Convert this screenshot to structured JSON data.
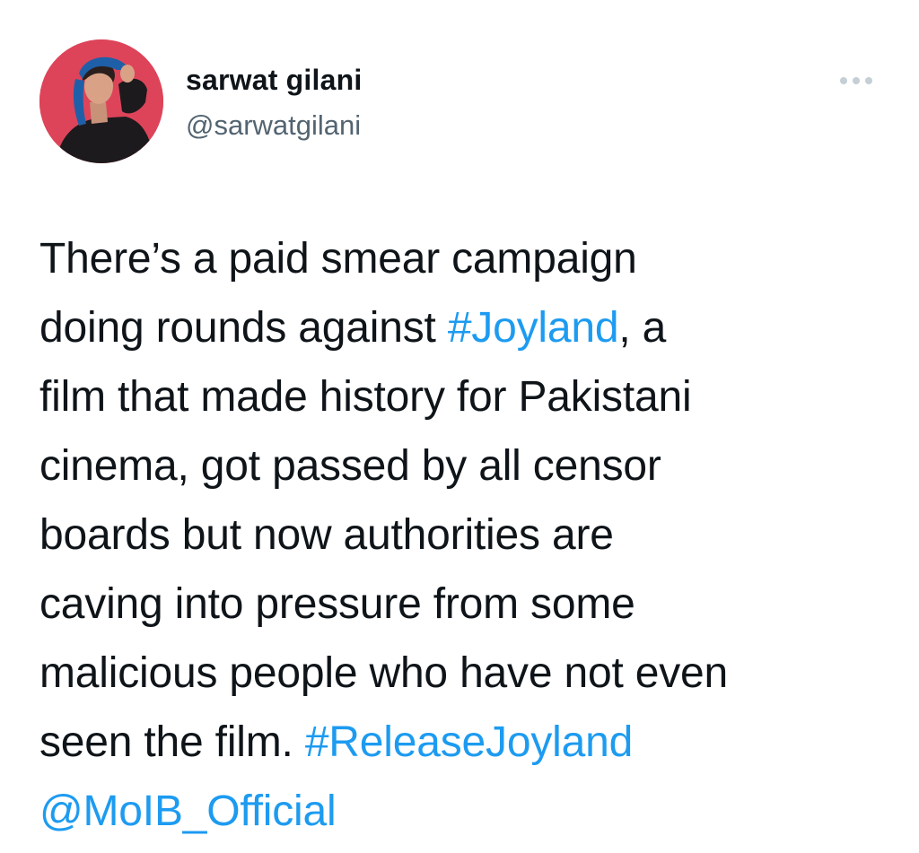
{
  "author": {
    "display_name": "sarwat gilani",
    "handle": "@sarwatgilani",
    "avatar_icon": "profile-photo"
  },
  "more_icon": "more-options-icon",
  "accent_color": "#1d9bf0",
  "tweet": {
    "lines": [
      [
        {
          "text": "There’s a paid smear campaign",
          "link": false
        }
      ],
      [
        {
          "text": "doing rounds against ",
          "link": false
        },
        {
          "text": "#Joyland",
          "link": true
        },
        {
          "text": ", a",
          "link": false
        }
      ],
      [
        {
          "text": "film that made history for Pakistani",
          "link": false
        }
      ],
      [
        {
          "text": "cinema, got passed by all censor",
          "link": false
        }
      ],
      [
        {
          "text": "boards but now authorities are",
          "link": false
        }
      ],
      [
        {
          "text": "caving into pressure from some",
          "link": false
        }
      ],
      [
        {
          "text": "malicious people who have not even",
          "link": false
        }
      ],
      [
        {
          "text": "seen the film. ",
          "link": false
        },
        {
          "text": "#ReleaseJoyland",
          "link": true
        }
      ],
      [
        {
          "text": "@MoIB_Official",
          "link": true
        }
      ]
    ]
  }
}
